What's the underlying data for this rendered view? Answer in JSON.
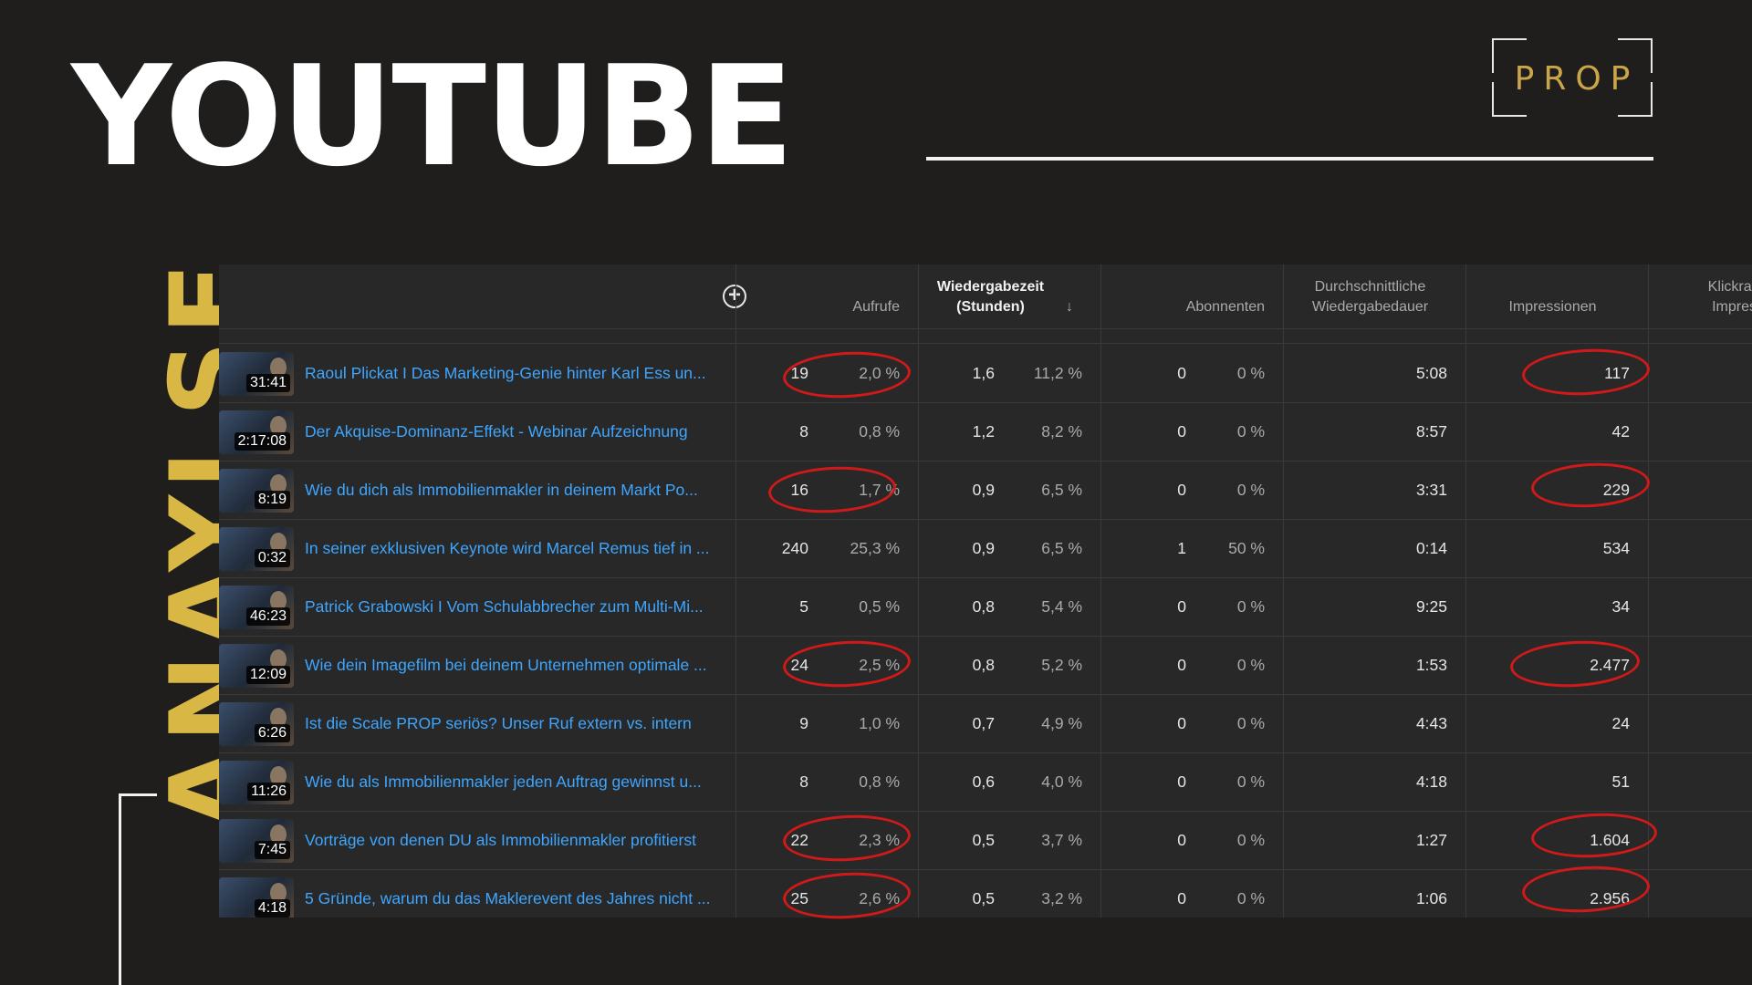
{
  "slide": {
    "title": "YOUTUBE",
    "side_title": "ANAYLSE",
    "logo_text": "PROP"
  },
  "table": {
    "headers": {
      "views": "Aufrufe",
      "watch_time": "Wiedergabezeit (Stunden)",
      "subscribers": "Abonnenten",
      "avg_duration": "Durchschnittliche Wiedergabedauer",
      "impressions": "Impressionen",
      "ctr": "Klickrate Impress"
    },
    "rows": [
      {
        "duration": "31:41",
        "title": "Raoul Plickat I Das Marketing-Genie hinter Karl Ess un...",
        "views": "19",
        "views_pct": "2,0 %",
        "watch": "1,6",
        "watch_pct": "11,2 %",
        "subs": "0",
        "subs_pct": "0 %",
        "avg": "5:08",
        "impressions": "117"
      },
      {
        "duration": "2:17:08",
        "title": "Der Akquise-Dominanz-Effekt - Webinar Aufzeichnung",
        "views": "8",
        "views_pct": "0,8 %",
        "watch": "1,2",
        "watch_pct": "8,2 %",
        "subs": "0",
        "subs_pct": "0 %",
        "avg": "8:57",
        "impressions": "42"
      },
      {
        "duration": "8:19",
        "title": "Wie du dich als Immobilienmakler in deinem Markt Po...",
        "views": "16",
        "views_pct": "1,7 %",
        "watch": "0,9",
        "watch_pct": "6,5 %",
        "subs": "0",
        "subs_pct": "0 %",
        "avg": "3:31",
        "impressions": "229"
      },
      {
        "duration": "0:32",
        "title": "In seiner exklusiven Keynote wird Marcel Remus tief in ...",
        "views": "240",
        "views_pct": "25,3 %",
        "watch": "0,9",
        "watch_pct": "6,5 %",
        "subs": "1",
        "subs_pct": "50 %",
        "avg": "0:14",
        "impressions": "534"
      },
      {
        "duration": "46:23",
        "title": "Patrick Grabowski I Vom Schulabbrecher zum Multi-Mi...",
        "views": "5",
        "views_pct": "0,5 %",
        "watch": "0,8",
        "watch_pct": "5,4 %",
        "subs": "0",
        "subs_pct": "0 %",
        "avg": "9:25",
        "impressions": "34"
      },
      {
        "duration": "12:09",
        "title": "Wie dein Imagefilm bei deinem Unternehmen optimale ...",
        "views": "24",
        "views_pct": "2,5 %",
        "watch": "0,8",
        "watch_pct": "5,2 %",
        "subs": "0",
        "subs_pct": "0 %",
        "avg": "1:53",
        "impressions": "2.477"
      },
      {
        "duration": "6:26",
        "title": "Ist die Scale PROP seriös? Unser Ruf extern vs. intern",
        "views": "9",
        "views_pct": "1,0 %",
        "watch": "0,7",
        "watch_pct": "4,9 %",
        "subs": "0",
        "subs_pct": "0 %",
        "avg": "4:43",
        "impressions": "24"
      },
      {
        "duration": "11:26",
        "title": "Wie du als Immobilienmakler jeden Auftrag gewinnst u...",
        "views": "8",
        "views_pct": "0,8 %",
        "watch": "0,6",
        "watch_pct": "4,0 %",
        "subs": "0",
        "subs_pct": "0 %",
        "avg": "4:18",
        "impressions": "51"
      },
      {
        "duration": "7:45",
        "title": "Vorträge von denen DU als Immobilienmakler profitierst",
        "views": "22",
        "views_pct": "2,3 %",
        "watch": "0,5",
        "watch_pct": "3,7 %",
        "subs": "0",
        "subs_pct": "0 %",
        "avg": "1:27",
        "impressions": "1.604"
      },
      {
        "duration": "4:18",
        "title": "5 Gründe, warum du das Maklerevent des Jahres nicht ...",
        "views": "25",
        "views_pct": "2,6 %",
        "watch": "0,5",
        "watch_pct": "3,2 %",
        "subs": "0",
        "subs_pct": "0 %",
        "avg": "1:06",
        "impressions": "2.956"
      }
    ]
  }
}
